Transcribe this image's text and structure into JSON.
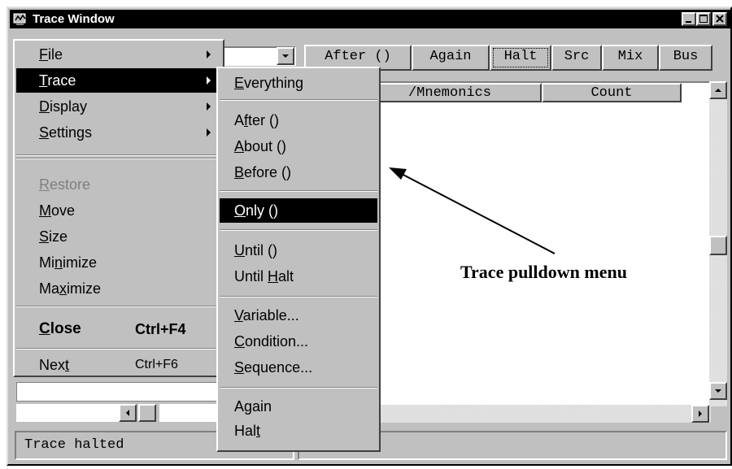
{
  "window": {
    "title": "Trace Window",
    "icon": "trace-app-icon"
  },
  "caption_buttons": [
    {
      "icon": "minimize-icon"
    },
    {
      "icon": "maximize-icon"
    },
    {
      "icon": "close-icon"
    }
  ],
  "toolbar": {
    "buttons": [
      "After ()",
      "Again",
      "Halt",
      "Src",
      "Mix",
      "Bus"
    ],
    "selected": "Halt"
  },
  "trace_list": {
    "columns": [
      "/Mnemonics",
      "Count"
    ]
  },
  "system_menu": {
    "items": [
      {
        "label": "File",
        "mnemonic": "F",
        "submenu": true
      },
      {
        "label": "Trace",
        "mnemonic": "T",
        "submenu": true,
        "highlighted": true
      },
      {
        "label": "Display",
        "mnemonic": "D",
        "submenu": true
      },
      {
        "label": "Settings",
        "mnemonic": "S",
        "submenu": true
      },
      {
        "label": "Restore",
        "mnemonic": "R",
        "disabled": true
      },
      {
        "label": "Move",
        "mnemonic": "M"
      },
      {
        "label": "Size",
        "mnemonic": "S"
      },
      {
        "label": "Minimize",
        "mnemonic": "n"
      },
      {
        "label": "Maximize",
        "mnemonic": "x"
      },
      {
        "label": "Close",
        "mnemonic": "C",
        "shortcut": "Ctrl+F4",
        "bold": true
      },
      {
        "label": "Next",
        "mnemonic": "t",
        "shortcut": "Ctrl+F6"
      }
    ]
  },
  "trace_submenu": {
    "items": [
      {
        "label": "Everything",
        "mnemonic": "E"
      },
      {
        "label": "After ()",
        "mnemonic": "f"
      },
      {
        "label": "About ()",
        "mnemonic": "A"
      },
      {
        "label": "Before ()",
        "mnemonic": "B"
      },
      {
        "label": "Only ()",
        "mnemonic": "O",
        "highlighted": true
      },
      {
        "label": "Until ()",
        "mnemonic": "U"
      },
      {
        "label": "Until Halt",
        "mnemonic": "H"
      },
      {
        "label": "Variable...",
        "mnemonic": "V"
      },
      {
        "label": "Condition...",
        "mnemonic": "C"
      },
      {
        "label": "Sequence...",
        "mnemonic": "S"
      },
      {
        "label": "Again",
        "mnemonic": "g"
      },
      {
        "label": "Halt",
        "mnemonic": "t"
      }
    ]
  },
  "status": {
    "text": "Trace halted"
  },
  "annotation": {
    "text": "Trace pulldown menu"
  },
  "colors": {
    "face": "#c0c0c0",
    "highlight": "#000000",
    "titlebar": "#000000"
  }
}
